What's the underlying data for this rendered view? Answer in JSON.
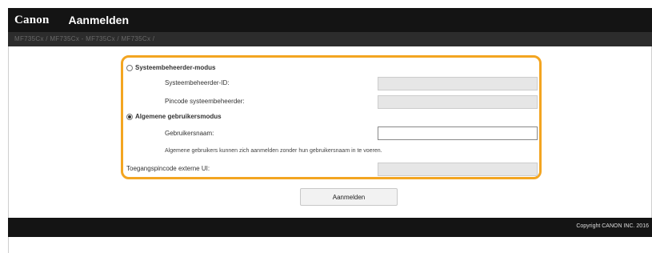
{
  "header": {
    "logo": "Canon",
    "title": "Aanmelden"
  },
  "subbar": {
    "breadcrumb": "MF735Cx / MF735Cx - MF735Cx / MF735Cx /"
  },
  "form": {
    "admin_mode": {
      "label": "Systeembeheerder-modus",
      "selected": false,
      "id_label": "Systeembeheerder-ID:",
      "id_value": "",
      "pin_label": "Pincode systeembeheerder:",
      "pin_value": ""
    },
    "user_mode": {
      "label": "Algemene gebruikersmodus",
      "selected": true,
      "username_label": "Gebruikersnaam:",
      "username_value": "",
      "note": "Algemene gebruikers kunnen zich aanmelden zonder hun gebruikersnaam in te voeren."
    },
    "remote_ui_pin": {
      "label": "Toegangspincode externe UI:",
      "value": ""
    }
  },
  "login_button": {
    "label": "Aanmelden"
  },
  "footer": {
    "copyright": "Copyright CANON INC. 2016"
  }
}
